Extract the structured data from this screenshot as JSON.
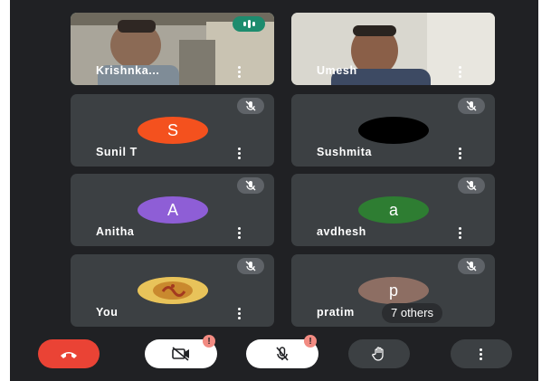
{
  "participants": [
    {
      "name": "Krishnka...",
      "type": "video",
      "speaking": true
    },
    {
      "name": "Umesh",
      "type": "video",
      "speaking": false
    },
    {
      "name": "Sunil T",
      "type": "avatar",
      "initial": "S",
      "color": "#f4511e",
      "muted": true
    },
    {
      "name": "Sushmita",
      "type": "avatar",
      "initial": "",
      "color": "#000000",
      "muted": true
    },
    {
      "name": "Anitha",
      "type": "avatar",
      "initial": "A",
      "color": "#8e5ed6",
      "muted": true
    },
    {
      "name": "avdhesh",
      "type": "avatar",
      "initial": "a",
      "color": "#2e7d32",
      "muted": true
    },
    {
      "name": "You",
      "type": "image-avatar",
      "muted": true
    },
    {
      "name": "pratim",
      "type": "avatar",
      "initial": "p",
      "color": "#8d6e63",
      "muted": true,
      "overlay": "7 others"
    }
  ],
  "controls": {
    "end_call_color": "#ea4335",
    "camera_badge": "!",
    "mic_badge": "!"
  },
  "icons": [
    "mic-off-icon",
    "more-vert-icon",
    "end-call-icon",
    "camera-off-icon",
    "raise-hand-icon",
    "speaking-indicator-icon"
  ]
}
